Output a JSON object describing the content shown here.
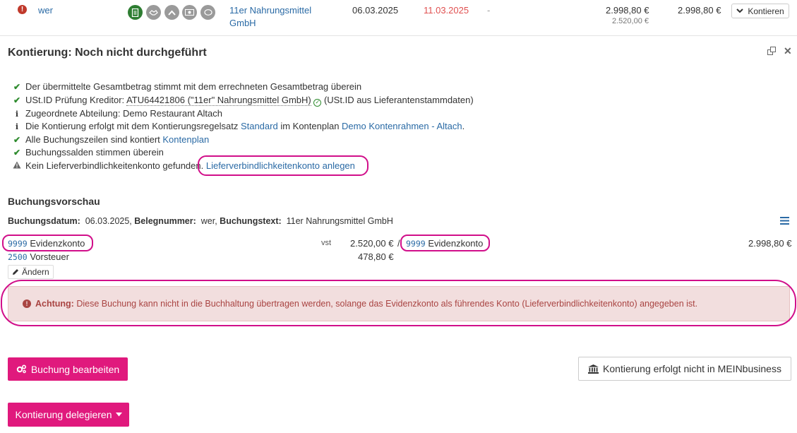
{
  "top_row": {
    "name": "wer",
    "supplier_line1": "11er Nahrungsmittel",
    "supplier_line2": "GmbH",
    "date1": "06.03.2025",
    "date2": "11.03.2025",
    "dash": "-",
    "amount_main": "2.998,80 €",
    "amount_sub": "2.520,00 €",
    "amount_total": "2.998,80 €",
    "kontieren_label": "Kontieren",
    "icons": [
      "document-icon",
      "handshake-icon",
      "chevron-up-icon",
      "money-icon",
      "comment-icon"
    ]
  },
  "panel": {
    "title": "Kontierung: Noch nicht durchgeführt"
  },
  "checks": {
    "c1": "Der übermittelte Gesamtbetrag stimmt mit dem errechneten Gesamtbetrag überein",
    "c2_pre": "USt.ID Prüfung Kreditor: ",
    "c2_id": "ATU64421806 (\"11er\" Nahrungsmittel GmbH)",
    "c2_post": "(USt.ID aus Lieferantenstammdaten)",
    "c3": "Zugeordnete Abteilung: Demo Restaurant Altach",
    "c4_pre": "Die Kontierung erfolgt mit dem Kontierungsregelsatz ",
    "c4_link1": "Standard",
    "c4_mid": " im Kontenplan ",
    "c4_link2": "Demo Kontenrahmen - Altach",
    "c4_post": ".",
    "c5_pre": "Alle Buchungszeilen sind kontiert ",
    "c5_link": "Kontenplan",
    "c6": "Buchungssalden stimmen überein",
    "c7_pre": "Kein Lieferverbindlichkeitenkonto gefunden. ",
    "c7_link": "Lieferverbindlichkeitenkonto anlegen"
  },
  "preview": {
    "title": "Buchungsvorschau",
    "date_label": "Buchungsdatum:",
    "date_value": "06.03.2025,",
    "beleg_label": "Belegnummer:",
    "beleg_value": "wer,",
    "text_label": "Buchungstext:",
    "text_value": "11er Nahrungsmittel GmbH",
    "row1_code": "9999",
    "row1_name": "Evidenzkonto",
    "row1_tax": "vst",
    "row1_amount": "2.520,00 €",
    "row1_sep": "/",
    "row1_credit_code": "9999",
    "row1_credit_name": "Evidenzkonto",
    "row1_credit_amount": "2.998,80 €",
    "row2_code": "2500",
    "row2_name": "Vorsteuer",
    "row2_amount": "478,80 €",
    "change_label": "Ändern"
  },
  "alert": {
    "strong": "Achtung:",
    "text": "Diese Buchung kann nicht in die Buchhaltung übertragen werden, solange das Evidenzkonto als führendes Konto (Lieferverbindlichkeitenkonto) angegeben ist."
  },
  "buttons": {
    "edit": "Buchung bearbeiten",
    "not_in_meinbusiness": "Kontierung erfolgt nicht in MEINbusiness",
    "delegate": "Kontierung delegieren"
  },
  "colors": {
    "accent_pink": "#e0197d",
    "link_blue": "#2a6aa5",
    "alert_bg": "#f2dede",
    "alert_text": "#a94442",
    "check_green": "#2e8b2e",
    "date_red": "#e05050"
  }
}
